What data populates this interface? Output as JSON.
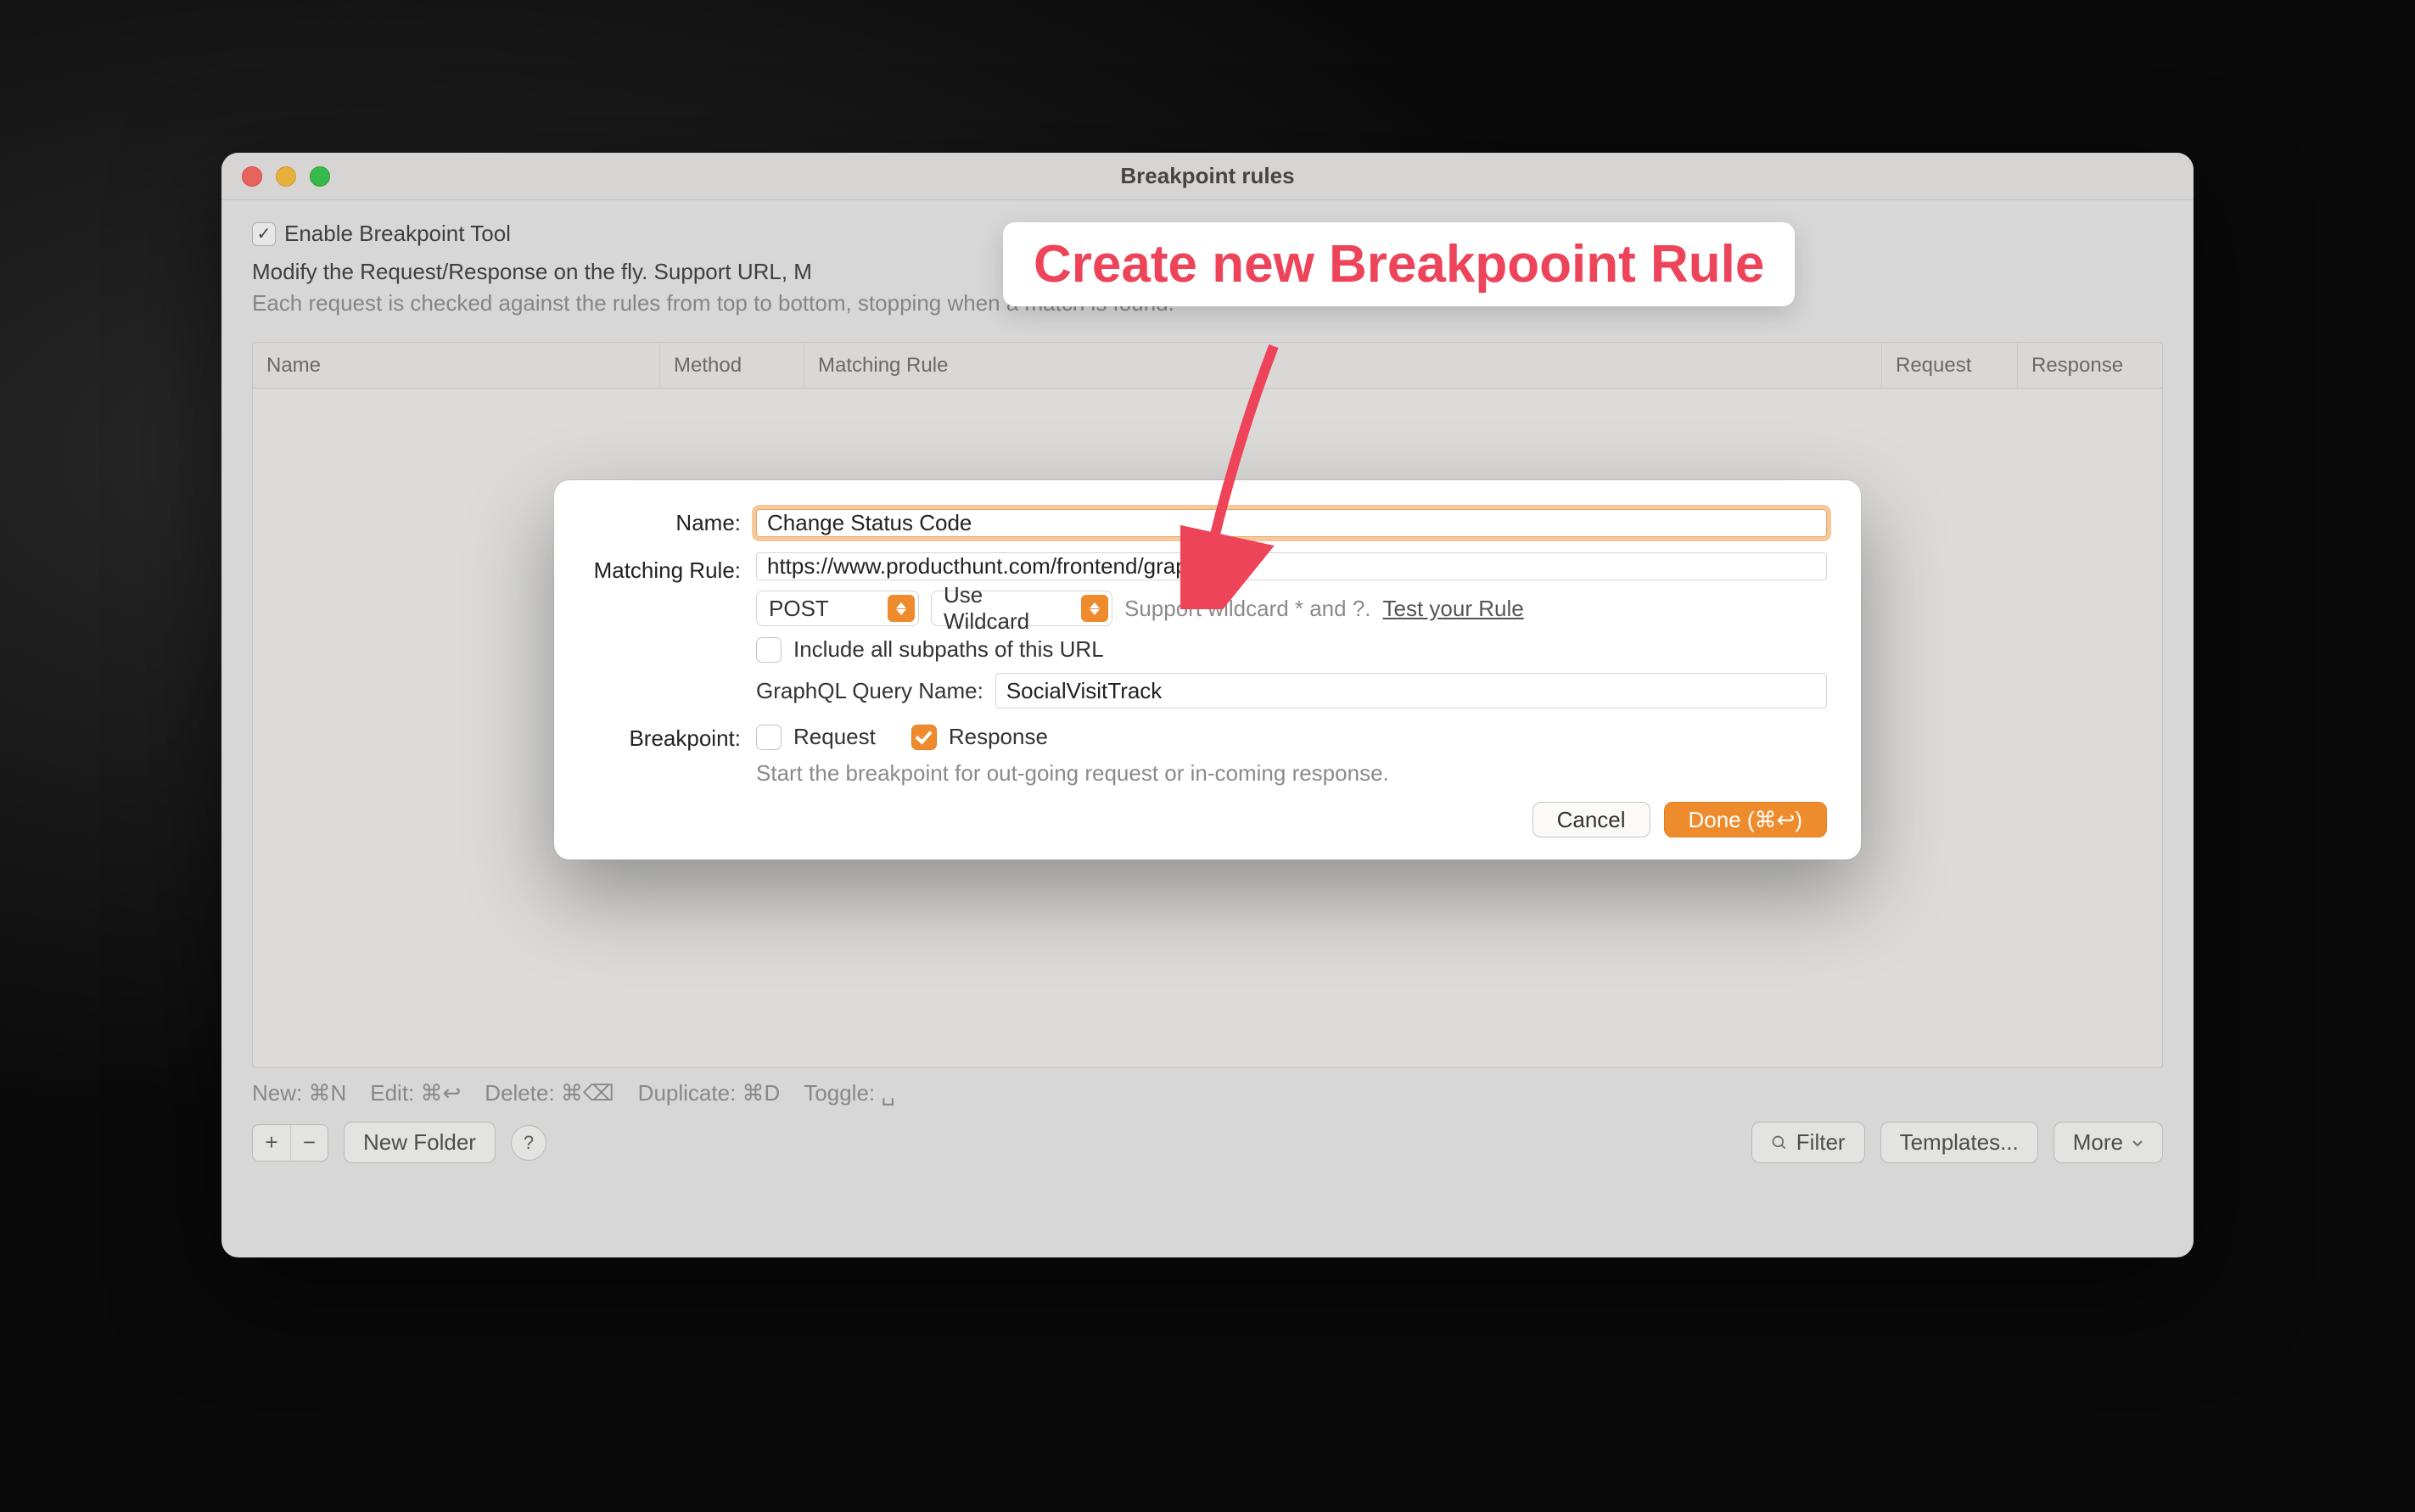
{
  "window": {
    "title": "Breakpoint rules"
  },
  "toolbar": {
    "enable_label": "Enable Breakpoint Tool",
    "enable_checked": true,
    "description_visible": "Modify the Request/Response on the fly. Support URL, M",
    "description_full": "Modify the Request/Response on the fly. Support URL, Method, Header, Body, and Status Code.",
    "subdescription": "Each request is checked against the rules from top to bottom, stopping when a match is found."
  },
  "table": {
    "columns": {
      "name": "Name",
      "method": "Method",
      "matching_rule": "Matching Rule",
      "request": "Request",
      "response": "Response"
    },
    "rows": []
  },
  "shortcuts": {
    "new": "New: ⌘N",
    "edit": "Edit: ⌘↩",
    "delete": "Delete: ⌘⌫",
    "duplicate": "Duplicate: ⌘D",
    "toggle": "Toggle: ␣"
  },
  "footer": {
    "new_folder": "New Folder",
    "filter": "Filter",
    "templates": "Templates...",
    "more": "More"
  },
  "modal": {
    "name_label": "Name:",
    "name_value": "Change Status Code",
    "matching_label": "Matching Rule:",
    "matching_value": "https://www.producthunt.com/frontend/graphql",
    "method_value": "POST",
    "wildcard_value": "Use Wildcard",
    "wildcard_hint": "Support wildcard * and ?.",
    "test_link": "Test your Rule",
    "include_subpaths_label": "Include all subpaths of this URL",
    "include_subpaths_checked": false,
    "graphql_label": "GraphQL Query Name:",
    "graphql_value": "SocialVisitTrack",
    "breakpoint_label": "Breakpoint:",
    "request_label": "Request",
    "request_checked": false,
    "response_label": "Response",
    "response_checked": true,
    "breakpoint_hint": "Start the breakpoint for out-going request or in-coming response.",
    "cancel": "Cancel",
    "done": "Done (⌘↩)"
  },
  "annotation": {
    "callout": "Create new Breakpooint Rule"
  }
}
